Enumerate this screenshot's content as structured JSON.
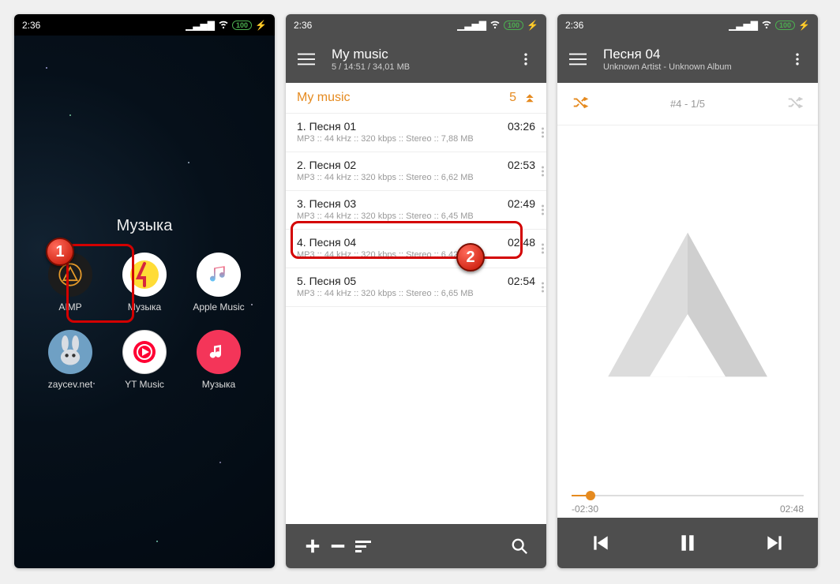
{
  "status": {
    "time": "2:36",
    "battery": "100"
  },
  "home": {
    "folder_title": "Музыка",
    "apps": [
      {
        "label": "AIMP"
      },
      {
        "label": "Музыка"
      },
      {
        "label": "Apple Music"
      },
      {
        "label": "zaycev.net"
      },
      {
        "label": "YT Music"
      },
      {
        "label": "Музыка"
      }
    ],
    "callouts": {
      "one": "1",
      "two": "2"
    }
  },
  "playlist": {
    "header_title": "My music",
    "header_sub": "5 / 14:51 / 34,01 MB",
    "list_title": "My music",
    "list_count": "5",
    "tracks": [
      {
        "title": "1. Песня 01",
        "meta": "MP3 :: 44 kHz :: 320 kbps :: Stereo :: 7,88 MB",
        "dur": "03:26"
      },
      {
        "title": "2. Песня 02",
        "meta": "MP3 :: 44 kHz :: 320 kbps :: Stereo :: 6,62 MB",
        "dur": "02:53"
      },
      {
        "title": "3. Песня 03",
        "meta": "MP3 :: 44 kHz :: 320 kbps :: Stereo :: 6,45 MB",
        "dur": "02:49"
      },
      {
        "title": "4. Песня 04",
        "meta": "MP3 :: 44 kHz :: 320 kbps :: Stereo :: 6,42 MB",
        "dur": "02:48"
      },
      {
        "title": "5. Песня 05",
        "meta": "MP3 :: 44 kHz :: 320 kbps :: Stereo :: 6,65 MB",
        "dur": "02:54"
      }
    ]
  },
  "nowplaying": {
    "title": "Песня 04",
    "subtitle": "Unknown Artist - Unknown Album",
    "position_text": "#4   -   1/5",
    "elapsed_neg": "-02:30",
    "duration": "02:48"
  }
}
